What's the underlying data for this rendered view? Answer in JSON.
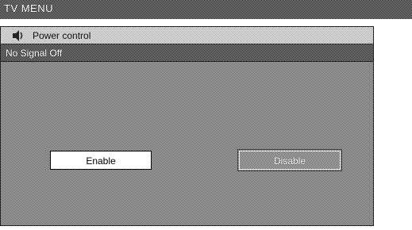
{
  "topbar": {
    "title": "TV MENU"
  },
  "panel": {
    "header": {
      "icon": "speaker-icon",
      "label": "Power control"
    },
    "subheader": {
      "label": "No Signal Off"
    },
    "buttons": {
      "enable_label": "Enable",
      "disable_label": "Disable",
      "selected": "Enable"
    }
  }
}
